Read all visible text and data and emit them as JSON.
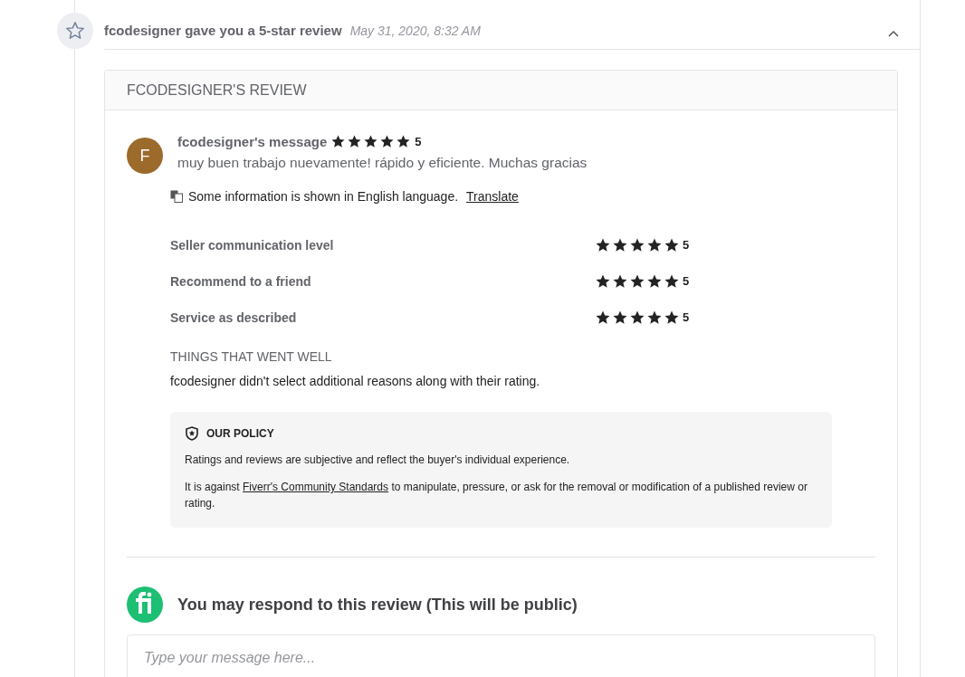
{
  "notification": {
    "title": "fcodesigner gave you a 5-star review",
    "time": "May 31, 2020, 8:32 AM",
    "expanded": true
  },
  "review": {
    "heading": "FCODESIGNER'S REVIEW",
    "message": {
      "avatar_letter": "F",
      "author": "fcodesigner's message",
      "stars": 5,
      "score": "5",
      "text": "muy buen trabajo nuevamente! rápido y eficiente. Muchas gracias"
    },
    "translation": {
      "notice": "Some information is shown in English language.",
      "link": "Translate"
    },
    "ratings": [
      {
        "label": "Seller communication level",
        "stars": 5,
        "score": "5"
      },
      {
        "label": "Recommend to a friend",
        "stars": 5,
        "score": "5"
      },
      {
        "label": "Service as described",
        "stars": 5,
        "score": "5"
      }
    ],
    "went_well": {
      "heading": "THINGS THAT WENT WELL",
      "text": "fcodesigner didn't select additional reasons along with their rating."
    },
    "policy": {
      "heading": "OUR POLICY",
      "text1": "Ratings and reviews are subjective and reflect the buyer's individual experience.",
      "text2_before": "It is against ",
      "link": "Fiverr's Community Standards",
      "text2_after": " to manipulate, pressure, or ask for the removal or modification of a published review or rating."
    },
    "respond": {
      "title": "You may respond to this review (This will be public)",
      "placeholder": "Type your message here..."
    }
  }
}
